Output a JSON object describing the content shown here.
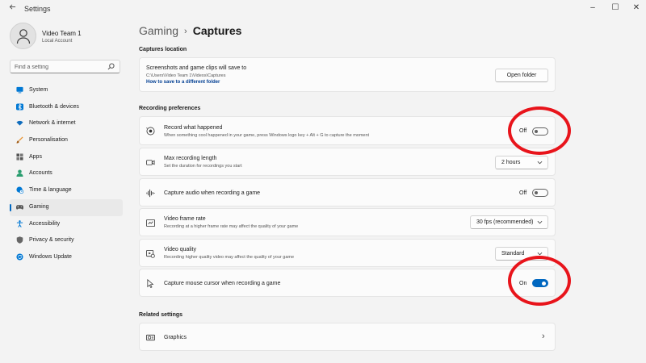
{
  "window": {
    "title": "Settings",
    "controls": {
      "minimize": "–",
      "maximize": "☐",
      "close": "✕"
    }
  },
  "profile": {
    "name": "Video Team 1",
    "account_type": "Local Account"
  },
  "search": {
    "placeholder": "Find a setting"
  },
  "sidebar": {
    "items": [
      {
        "label": "System",
        "icon": "monitor-icon",
        "color": "#0078d4"
      },
      {
        "label": "Bluetooth & devices",
        "icon": "bluetooth-icon",
        "color": "#0078d4"
      },
      {
        "label": "Network & internet",
        "icon": "wifi-icon",
        "color": "#0f6cbd"
      },
      {
        "label": "Personalisation",
        "icon": "brush-icon",
        "color": "#e8912d"
      },
      {
        "label": "Apps",
        "icon": "apps-icon",
        "color": "#555555"
      },
      {
        "label": "Accounts",
        "icon": "person-icon",
        "color": "#2a9d6f"
      },
      {
        "label": "Time & language",
        "icon": "globe-clock-icon",
        "color": "#0078d4"
      },
      {
        "label": "Gaming",
        "icon": "gamepad-icon",
        "color": "#555555",
        "active": true
      },
      {
        "label": "Accessibility",
        "icon": "accessibility-icon",
        "color": "#0078d4"
      },
      {
        "label": "Privacy & security",
        "icon": "shield-icon",
        "color": "#666666"
      },
      {
        "label": "Windows Update",
        "icon": "update-icon",
        "color": "#0078d4"
      }
    ]
  },
  "breadcrumb": {
    "parent": "Gaming",
    "separator": "›",
    "current": "Captures"
  },
  "captures_location": {
    "heading": "Captures location",
    "title": "Screenshots and game clips will save to",
    "path": "C:\\Users\\Video Team 1\\Videos\\Captures",
    "link": "How to save to a different folder",
    "button": "Open folder"
  },
  "recording": {
    "heading": "Recording preferences",
    "record_what_happened": {
      "title": "Record what happened",
      "desc": "When something cool happened in your game, press Windows logo key + Alt + G to capture the moment",
      "state": "Off"
    },
    "max_length": {
      "title": "Max recording length",
      "desc": "Set the duration for recordings you start",
      "value": "2 hours"
    },
    "capture_audio": {
      "title": "Capture audio when recording a game",
      "state": "Off"
    },
    "frame_rate": {
      "title": "Video frame rate",
      "desc": "Recording at a higher frame rate may affect the quality of your game",
      "value": "30 fps (recommended)"
    },
    "video_quality": {
      "title": "Video quality",
      "desc": "Recording higher quality video may affect the quality of your game",
      "value": "Standard"
    },
    "mouse_cursor": {
      "title": "Capture mouse cursor when recording a game",
      "state": "On"
    }
  },
  "related": {
    "heading": "Related settings",
    "graphics": "Graphics",
    "chevron": "›"
  },
  "colors": {
    "accent": "#0067c0",
    "annotation": "#e8141b"
  }
}
